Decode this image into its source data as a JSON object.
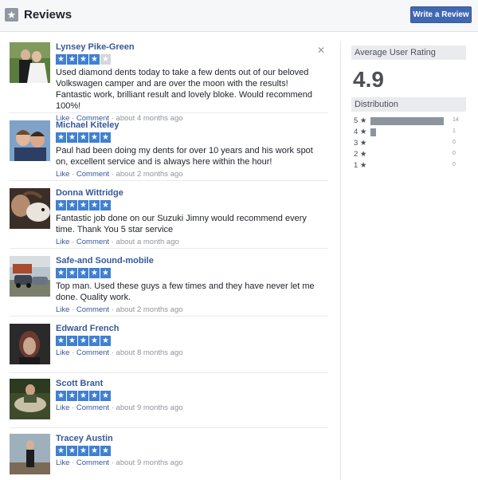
{
  "header": {
    "title": "Reviews",
    "write_review_label": "Write a Review"
  },
  "reviews": [
    {
      "name": "Lynsey Pike-Green",
      "stars": 4,
      "text": "Used diamond dents today to take a few dents out of our beloved Volkswagen camper and are over the moon with the results! Fantastic work, brilliant result and lovely bloke. Would recommend 100%!",
      "like": "Like",
      "comment": "Comment",
      "time": "about 4 months ago"
    },
    {
      "name": "Michael Kiteley",
      "stars": 5,
      "text": "Paul had been doing my dents for over 10 years and his work spot on, excellent service and is always here within the hour!",
      "like": "Like",
      "comment": "Comment",
      "time": "about 2 months ago"
    },
    {
      "name": "Donna Wittridge",
      "stars": 5,
      "text": "Fantastic job done on our Suzuki Jimny would recommend every time. Thank You 5 star service",
      "like": "Like",
      "comment": "Comment",
      "time": "about a month ago"
    },
    {
      "name": "Safe-and Sound-mobile",
      "stars": 5,
      "text": "Top man. Used these guys a few times and they have never let me done. Quality work.",
      "like": "Like",
      "comment": "Comment",
      "time": "about 2 months ago"
    },
    {
      "name": "Edward French",
      "stars": 5,
      "text": "",
      "like": "Like",
      "comment": "Comment",
      "time": "about 8 months ago"
    },
    {
      "name": "Scott Brant",
      "stars": 5,
      "text": "",
      "like": "Like",
      "comment": "Comment",
      "time": "about 9 months ago"
    },
    {
      "name": "Tracey Austin",
      "stars": 5,
      "text": "",
      "like": "Like",
      "comment": "Comment",
      "time": "about 9 months ago"
    }
  ],
  "sidebar": {
    "average_label": "Average User Rating",
    "average_value": "4.9",
    "distribution_label": "Distribution",
    "distribution": [
      {
        "label": "5 ★",
        "count": 14
      },
      {
        "label": "4 ★",
        "count": 1
      },
      {
        "label": "3 ★",
        "count": 0
      },
      {
        "label": "2 ★",
        "count": 0
      },
      {
        "label": "1 ★",
        "count": 0
      }
    ]
  },
  "colors": {
    "accent": "#4267b2",
    "link": "#365899",
    "star": "#4080d0",
    "bar": "#8d949e"
  },
  "icons": {
    "header": "star-icon",
    "close": "close-icon"
  }
}
